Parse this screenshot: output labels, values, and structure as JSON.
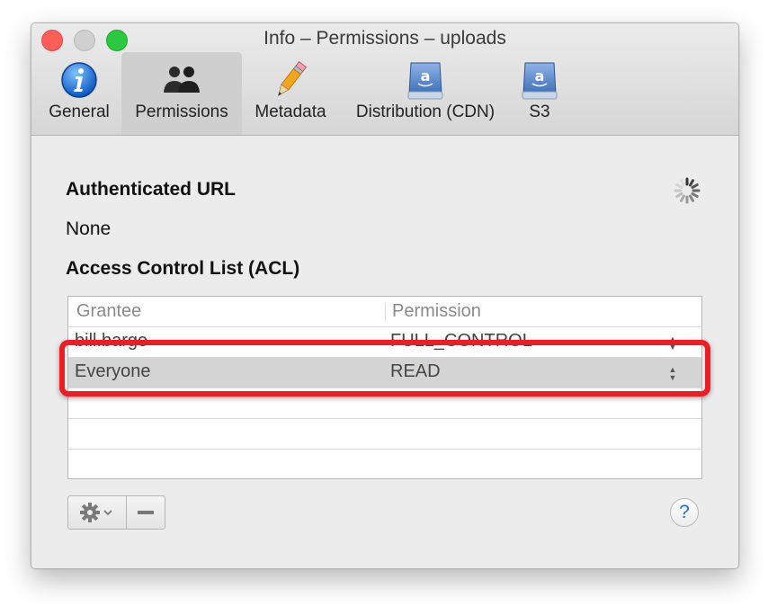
{
  "window": {
    "title": "Info – Permissions – uploads"
  },
  "toolbar": {
    "items": [
      {
        "label": "General",
        "icon": "info-icon"
      },
      {
        "label": "Permissions",
        "icon": "users-icon",
        "selected": true
      },
      {
        "label": "Metadata",
        "icon": "pencil-icon"
      },
      {
        "label": "Distribution (CDN)",
        "icon": "amazon-drive-icon"
      },
      {
        "label": "S3",
        "icon": "amazon-drive-icon"
      }
    ]
  },
  "auth": {
    "heading": "Authenticated URL",
    "value": "None"
  },
  "acl": {
    "heading": "Access Control List (ACL)",
    "columns": [
      "Grantee",
      "Permission"
    ],
    "rows": [
      {
        "grantee": "bill.barge",
        "permission": "FULL_CONTROL"
      },
      {
        "grantee": "Everyone",
        "permission": "READ",
        "selected": true
      }
    ]
  },
  "buttons": {
    "help": "?"
  },
  "colors": {
    "highlight": "#ee1c24",
    "help_accent": "#1f6fd6"
  }
}
